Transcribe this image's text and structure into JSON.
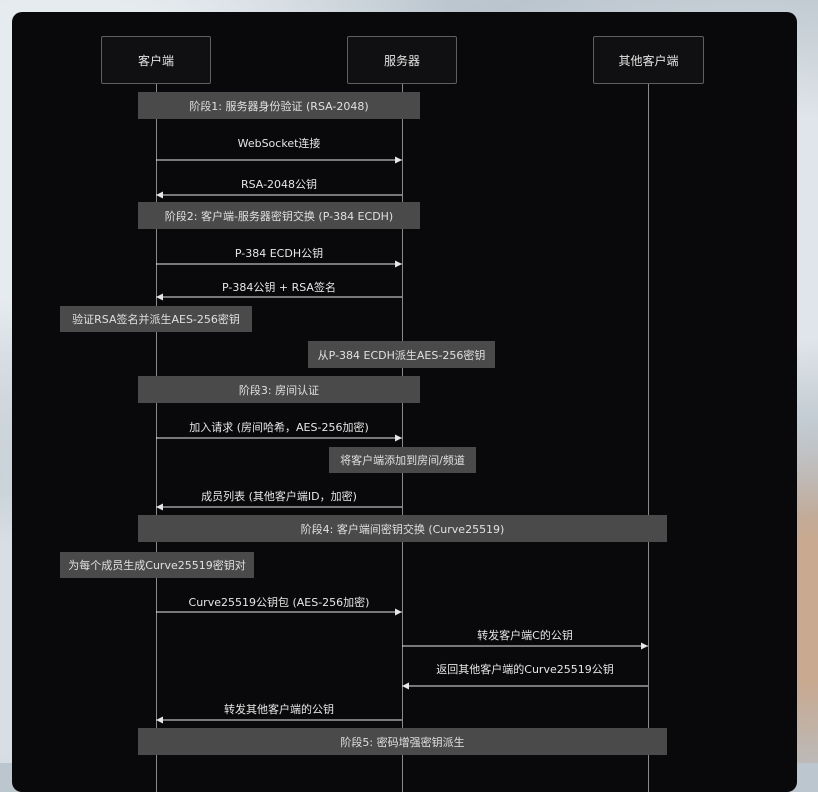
{
  "participants": {
    "client": "客户端",
    "server": "服务器",
    "other_clients": "其他客户端"
  },
  "phases": {
    "p1": "阶段1: 服务器身份验证 (RSA-2048)",
    "p2": "阶段2: 客户端-服务器密钥交换 (P-384 ECDH)",
    "p3": "阶段3: 房间认证",
    "p4": "阶段4: 客户端间密钥交换 (Curve25519)",
    "p5": "阶段5: 密码增强密钥派生"
  },
  "notes": {
    "verify_rsa": "验证RSA签名并派生AES-256密钥",
    "derive_server": "从P-384 ECDH派生AES-256密钥",
    "add_to_room": "将客户端添加到房间/频道",
    "gen_curve_keys": "为每个成员生成Curve25519密钥对"
  },
  "messages": {
    "m1": "WebSocket连接",
    "m2": "RSA-2048公钥",
    "m3": "P-384 ECDH公钥",
    "m4": "P-384公钥 + RSA签名",
    "m5": "加入请求 (房间哈希，AES-256加密)",
    "m6": "成员列表 (其他客户端ID，加密)",
    "m7": "Curve25519公钥包 (AES-256加密)",
    "m8": "转发客户端C的公钥",
    "m9": "返回其他客户端的Curve25519公钥",
    "m10": "转发其他客户端的公钥"
  },
  "colors": {
    "canvas": "#09090b",
    "note_fill": "#4a4a4a",
    "line": "#8a8a8a",
    "text": "#e6e6e6"
  }
}
